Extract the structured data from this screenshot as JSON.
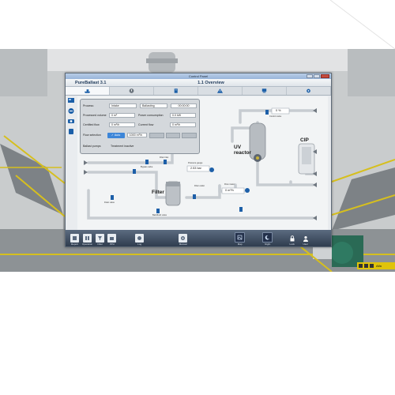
{
  "window": {
    "title": "Control Panel",
    "app_name": "PureBallast 3.1",
    "screen_title": "1.1 Overview"
  },
  "tabs": [
    {
      "icon": "ballast-ship-icon",
      "active": true
    },
    {
      "icon": "alarm-icon",
      "active": false
    },
    {
      "icon": "clipboard-icon",
      "active": false
    },
    {
      "icon": "warning-icon",
      "active": false
    },
    {
      "icon": "system-icon",
      "active": false
    },
    {
      "icon": "settings-gear-icon",
      "active": false
    }
  ],
  "panel": {
    "process_label": "Process:",
    "process_value": "Intake",
    "state_value": "Ballasting",
    "time_value": "00:00:00",
    "processed_volume_label": "Processed volume",
    "processed_volume_value": "0 m³",
    "power_consumption_label": "Power consumption",
    "power_consumption_value": "0.0 kW",
    "certified_flow_label": "Certified flow",
    "certified_flow_value": "0 m³/h",
    "current_flow_label": "Current flow",
    "current_flow_value": "0 m³/h",
    "flow_selection_label": "Flow selection",
    "flow_mode": "Auto",
    "flow_setpoint": "1000 m³/h",
    "ballast_pumps_label": "Ballast pumps",
    "treatment_status": "Treatment inactive"
  },
  "diagram": {
    "uv_reactor_label": "UV reactor",
    "filter_label": "Filter",
    "cip_label": "CIP",
    "control_valve_percent": "0 %",
    "pressure_gauge_value": "2.53 bar",
    "flow_meter_value": "0 m³/h",
    "uv_control_valve_label": "Control valve",
    "pressure_gauge_label": "Pressure gauge",
    "flow_meter_label": "Flow meter",
    "filter_outlet_label": "Filter outlet",
    "bypass_valve_label": "Bypass valve",
    "backflush_valve_label": "Backflush valve",
    "drain_valve_label": "Drain valve",
    "filter_inlet_label": "Filter inlet"
  },
  "footer": [
    {
      "label": "Report",
      "icon": "report-icon"
    },
    {
      "label": "Operation",
      "icon": "operation-icon"
    },
    {
      "label": "Filter",
      "icon": "filter-icon"
    },
    {
      "label": "PPd",
      "icon": "ppd-icon"
    },
    {
      "label": "Log",
      "icon": "log-icon"
    },
    {
      "label": "Manual",
      "icon": "manual-icon"
    },
    {
      "label": "Map",
      "icon": "map-icon"
    },
    {
      "label": "Night",
      "icon": "night-icon"
    },
    {
      "label": "Lock",
      "icon": "lock-icon"
    },
    {
      "label": "User",
      "icon": "user-icon"
    }
  ],
  "status_bar": {
    "value": "Alfa"
  },
  "colors": {
    "accent_blue": "#3d86d8",
    "footer": "#3a475a",
    "status_yellow": "#e0c30a"
  }
}
